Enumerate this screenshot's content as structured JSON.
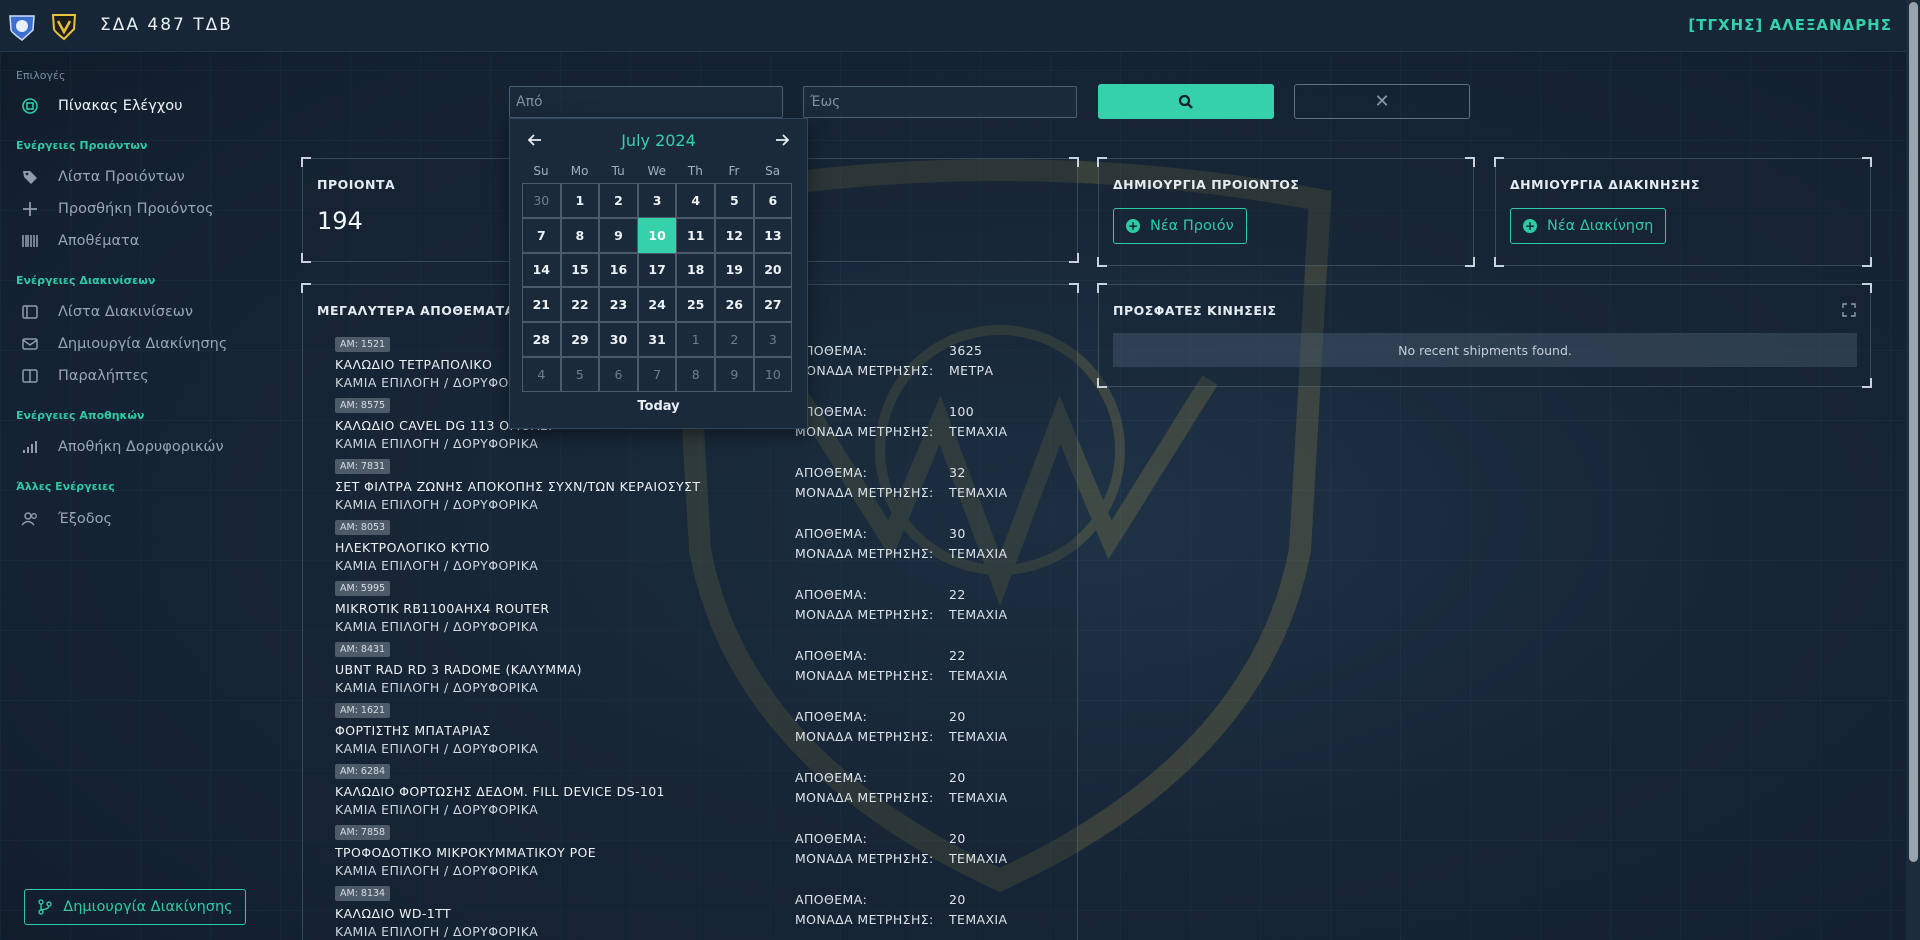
{
  "header": {
    "brand": "ΣΔΑ 487 ΤΔΒ",
    "user": "[ΤΓΧΗΣ] ΑΛΕΞΑΝΔΡΗΣ"
  },
  "sidebar": {
    "sections": [
      {
        "label": "Επιλογές",
        "items": [
          {
            "label": "Πίνακας Ελέγχου",
            "icon": "dashboard-icon"
          }
        ]
      },
      {
        "label": "Ενέργειες Προιόντων",
        "items": [
          {
            "label": "Λίστα Προιόντων",
            "icon": "tags-icon"
          },
          {
            "label": "Προσθήκη Προιόντος",
            "icon": "plus-icon"
          },
          {
            "label": "Αποθέματα",
            "icon": "barcode-icon"
          }
        ]
      },
      {
        "label": "Ενέργειες Διακινίσεων",
        "items": [
          {
            "label": "Λίστα Διακινίσεων",
            "icon": "sidebar-panel-icon"
          },
          {
            "label": "Δημιουργία Διακίνησης",
            "icon": "envelope-icon"
          },
          {
            "label": "Παραλήπτες",
            "icon": "columns-icon"
          }
        ]
      },
      {
        "label": "Ενέργειες Αποθηκών",
        "items": [
          {
            "label": "Αποθήκη Δορυφορικών",
            "icon": "signal-bars-icon"
          }
        ]
      },
      {
        "label": "Άλλες Ενέργειες",
        "items": [
          {
            "label": "Έξοδος",
            "icon": "users-icon"
          }
        ]
      }
    ],
    "bottom_button": "Δημιουργία Διακίνησης"
  },
  "filters": {
    "from_placeholder": "Από",
    "to_placeholder": "Έως",
    "search_icon": "search-icon",
    "clear_symbol": "✕"
  },
  "calendar": {
    "month_label": "July 2024",
    "weekdays": [
      "Su",
      "Mo",
      "Tu",
      "We",
      "Th",
      "Fr",
      "Sa"
    ],
    "days": [
      "30",
      "1",
      "2",
      "3",
      "4",
      "5",
      "6",
      "7",
      "8",
      "9",
      "10",
      "11",
      "12",
      "13",
      "14",
      "15",
      "16",
      "17",
      "18",
      "19",
      "20",
      "21",
      "22",
      "23",
      "24",
      "25",
      "26",
      "27",
      "28",
      "29",
      "30",
      "31",
      "1",
      "2",
      "3",
      "4",
      "5",
      "6",
      "7",
      "8",
      "9",
      "10"
    ],
    "outside_indices": [
      0,
      32,
      33,
      34,
      35,
      36,
      37,
      38,
      39,
      40,
      41
    ],
    "selected_index": 10,
    "today_label": "Today"
  },
  "cards": {
    "products": {
      "title": "ΠΡΟΙΟΝΤΑ",
      "count": "194"
    },
    "create_product": {
      "title": "ΔΗΜΙΟΥΡΓΙΑ ΠΡΟΙΟΝΤΟΣ",
      "button": "Νέα Προιόν"
    },
    "create_shipment": {
      "title": "ΔΗΜΙΟΥΡΓΙΑ ΔΙΑΚΙΝΗΣΗΣ",
      "button": "Νέα Διακίνηση"
    },
    "recent": {
      "title": "ΠΡΟΣΦΑΤΕΣ ΚΙΝΗΣΕΙΣ",
      "empty": "No recent shipments found."
    },
    "largest_stock": {
      "title": "ΜΕΓΑΛΥΤΕΡΑ ΑΠΟΘΕΜΑΤΑ"
    }
  },
  "stock_labels": {
    "stock": "ΑΠΟΘΕΜΑ:",
    "unit": "ΜΟΝΑΔΑ ΜΕΤΡΗΣΗΣ:"
  },
  "stock_items": [
    {
      "am": "ΑΜ: 1521",
      "name": "ΚΑΛΩΔΙΟ ΤΕΤΡΑΠΟΛΙΚΟ",
      "category": "ΚΑΜΙΑ ΕΠΙΛΟΓΗ / ΔΟΡΥΦΟΡΙΚΑ",
      "stock": "3625",
      "unit": "ΜΕΤΡΑ"
    },
    {
      "am": "ΑΜ: 8575",
      "name": "ΚΑΛΩΔΙΟ CAVEL DG 113 ΟΜΟΑΞ.",
      "category": "ΚΑΜΙΑ ΕΠΙΛΟΓΗ / ΔΟΡΥΦΟΡΙΚΑ",
      "stock": "100",
      "unit": "ΤΕΜΑΧΙΑ"
    },
    {
      "am": "ΑΜ: 7831",
      "name": "ΣΕΤ ΦΙΛΤΡΑ ΖΩΝΗΣ ΑΠΟΚΟΠΗΣ ΣΥΧΝ/ΤΩΝ ΚΕΡΑΙΟΣΥΣΤ",
      "category": "ΚΑΜΙΑ ΕΠΙΛΟΓΗ / ΔΟΡΥΦΟΡΙΚΑ",
      "stock": "32",
      "unit": "ΤΕΜΑΧΙΑ"
    },
    {
      "am": "ΑΜ: 8053",
      "name": "ΗΛΕΚΤΡΟΛΟΓΙΚΟ ΚΥΤΙΟ",
      "category": "ΚΑΜΙΑ ΕΠΙΛΟΓΗ / ΔΟΡΥΦΟΡΙΚΑ",
      "stock": "30",
      "unit": "ΤΕΜΑΧΙΑ"
    },
    {
      "am": "ΑΜ: 5995",
      "name": "MIKROTIK RB1100AHX4 ROUTER",
      "category": "ΚΑΜΙΑ ΕΠΙΛΟΓΗ / ΔΟΡΥΦΟΡΙΚΑ",
      "stock": "22",
      "unit": "ΤΕΜΑΧΙΑ"
    },
    {
      "am": "ΑΜ: 8431",
      "name": "UBNT RAD RD 3 RADOME (ΚΑΛΥΜΜΑ)",
      "category": "ΚΑΜΙΑ ΕΠΙΛΟΓΗ / ΔΟΡΥΦΟΡΙΚΑ",
      "stock": "22",
      "unit": "ΤΕΜΑΧΙΑ"
    },
    {
      "am": "ΑΜ: 1621",
      "name": "ΦΟΡΤΙΣΤΗΣ ΜΠΑΤΑΡΙΑΣ",
      "category": "ΚΑΜΙΑ ΕΠΙΛΟΓΗ / ΔΟΡΥΦΟΡΙΚΑ",
      "stock": "20",
      "unit": "ΤΕΜΑΧΙΑ"
    },
    {
      "am": "ΑΜ: 6284",
      "name": "ΚΑΛΩΔΙΟ ΦΟΡΤΩΣΗΣ ΔΕΔΟΜ. FILL DEVICE DS-101",
      "category": "ΚΑΜΙΑ ΕΠΙΛΟΓΗ / ΔΟΡΥΦΟΡΙΚΑ",
      "stock": "20",
      "unit": "ΤΕΜΑΧΙΑ"
    },
    {
      "am": "ΑΜ: 7858",
      "name": "ΤΡΟΦΟΔΟΤΙΚΟ ΜΙΚΡΟΚΥΜΜΑΤΙΚΟΥ POE",
      "category": "ΚΑΜΙΑ ΕΠΙΛΟΓΗ / ΔΟΡΥΦΟΡΙΚΑ",
      "stock": "20",
      "unit": "ΤΕΜΑΧΙΑ"
    },
    {
      "am": "ΑΜ: 8134",
      "name": "ΚΑΛΩΔΙΟ WD-1TT",
      "category": "ΚΑΜΙΑ ΕΠΙΛΟΓΗ / ΔΟΡΥΦΟΡΙΚΑ",
      "stock": "20",
      "unit": "ΤΕΜΑΧΙΑ"
    }
  ],
  "colors": {
    "accent": "#34d1aa",
    "background": "#172637",
    "panel": "#1b2a3a"
  }
}
